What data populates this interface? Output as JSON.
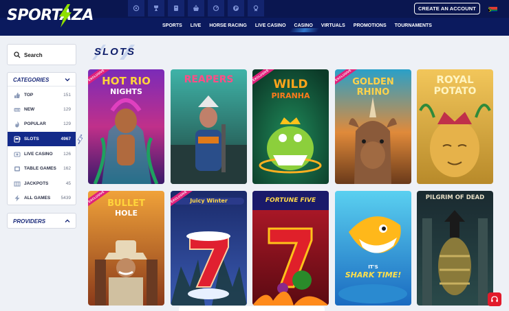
{
  "brand": {
    "name": "SPORTAZA"
  },
  "header": {
    "quick_icons": [
      "football-icon",
      "trophy-icon",
      "tickets-icon",
      "basket-icon",
      "refresh-icon",
      "promo-icon",
      "award-icon"
    ],
    "create_account_label": "CREATE AN ACCOUNT",
    "nav": [
      {
        "label": "SPORTS",
        "active": false
      },
      {
        "label": "LIVE",
        "active": false
      },
      {
        "label": "HORSE RACING",
        "active": false
      },
      {
        "label": "LIVE CASINO",
        "active": false
      },
      {
        "label": "CASINO",
        "active": true
      },
      {
        "label": "VIRTUALS",
        "active": false
      },
      {
        "label": "PROMOTIONS",
        "active": false
      },
      {
        "label": "TOURNAMENTS",
        "active": false
      }
    ]
  },
  "search": {
    "placeholder": "Search"
  },
  "sidebar": {
    "categories_title": "CATEGORIES",
    "categories": [
      {
        "label": "TOP",
        "count": "151",
        "icon": "thumbs-up-icon",
        "active": false
      },
      {
        "label": "NEW",
        "count": "129",
        "icon": "new-badge-icon",
        "active": false
      },
      {
        "label": "POPULAR",
        "count": "129",
        "icon": "flame-icon",
        "active": false
      },
      {
        "label": "SLOTS",
        "count": "4967",
        "icon": "slot-machine-icon",
        "active": true
      },
      {
        "label": "LIVE CASINO",
        "count": "126",
        "icon": "live-casino-icon",
        "active": false
      },
      {
        "label": "TABLE GAMES",
        "count": "162",
        "icon": "table-games-icon",
        "active": false
      },
      {
        "label": "JACKPOTS",
        "count": "45",
        "icon": "jackpot-icon",
        "active": false
      },
      {
        "label": "ALL GAMES",
        "count": "5439",
        "icon": "all-games-icon",
        "active": false
      }
    ],
    "providers_title": "PROVIDERS"
  },
  "main": {
    "section_title": "SLOTS",
    "games": [
      {
        "title_lines": [
          "HOT RIO",
          "NIGHTS"
        ],
        "exclusive": true
      },
      {
        "title_lines": [
          "REAPERS"
        ],
        "exclusive": false
      },
      {
        "title_lines": [
          "WILD",
          "PIRANHA"
        ],
        "exclusive": true
      },
      {
        "title_lines": [
          "GOLDEN",
          "RHINO"
        ],
        "exclusive": true
      },
      {
        "title_lines": [
          "ROYAL",
          "POTATO"
        ],
        "exclusive": false
      },
      {
        "title_lines": [
          "BULLET",
          "HOLE"
        ],
        "exclusive": true
      },
      {
        "title_lines": [
          "Juicy Winter"
        ],
        "exclusive": true
      },
      {
        "title_lines": [
          "FORTUNE FIVE"
        ],
        "exclusive": false
      },
      {
        "title_lines": [
          "IT'S",
          "SHARK TIME!"
        ],
        "exclusive": false
      },
      {
        "title_lines": [
          "PILGRIM OF DEAD"
        ],
        "exclusive": false
      }
    ],
    "exclusive_label": "EXCLUSIVE"
  },
  "colors": {
    "header_bg": "#0b1a5e",
    "accent_green": "#8fe000",
    "active_category": "#132a8a",
    "exclusive_ribbon": "#e0207a",
    "support_red": "#e21b2b"
  }
}
